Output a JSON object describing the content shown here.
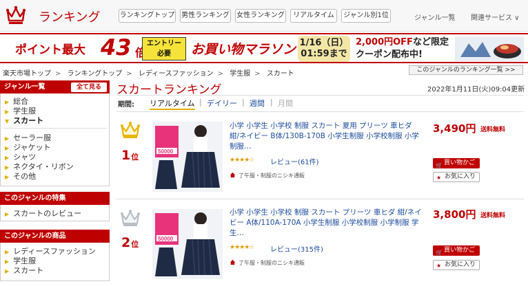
{
  "header": {
    "logo_text": "ランキング",
    "tabs": [
      {
        "label": "ランキングトップ"
      },
      {
        "label": "男性ランキング"
      },
      {
        "label": "女性ランキング"
      },
      {
        "label": "リアルタイム"
      },
      {
        "label": "ジャンル別1位"
      }
    ],
    "nav_genre_list": "ジャンル一覧",
    "nav_related": "関連サービス ∨"
  },
  "banner": {
    "point_text": "ポイント最大",
    "point_value": "43",
    "point_unit": "倍",
    "entry_line1": "エントリー",
    "entry_line2": "必要",
    "marathon": "お買い物マラソン",
    "date_line1": "1/16（日）",
    "date_line2": "01:59まで",
    "offer_line1_red": "2,000円OFF",
    "offer_line1_rest": "など限定",
    "offer_line2": "クーポン配布中!"
  },
  "breadcrumb": {
    "items": [
      "楽天市場トップ",
      "ランキングトップ",
      "レディースファッション",
      "学生服",
      "スカート"
    ],
    "separator": ">",
    "genre_ranking_link": "このジャンルのランキング一覧 >>"
  },
  "sidebar": {
    "genre_header": "ジャンル一覧",
    "see_all": "全て見る",
    "group1": [
      "総合",
      "学生服",
      "スカート"
    ],
    "group2": [
      "セーラー服",
      "ジャケット",
      "シャツ",
      "ネクタイ・リボン",
      "その他"
    ],
    "features_header": "このジャンルの特集",
    "features": [
      "スカートのレビュー"
    ],
    "products_header": "このジャンルの商品",
    "products": [
      "レディースファッション",
      "学生服",
      "スカート"
    ]
  },
  "main": {
    "title": "スカートランキング",
    "updated": "2022年1月11日(火)09:04更新",
    "period_label": "期間:",
    "period_tabs": [
      {
        "label": "リアルタイム"
      },
      {
        "label": "デイリー"
      },
      {
        "label": "週間"
      },
      {
        "label": "月間"
      }
    ],
    "period_sep": "|",
    "rank_suffix": "位",
    "items": [
      {
        "rank": "1",
        "name": "小学 小学生 小学校 制服 スカート 夏用 プリーツ 車ヒダ 紺/ネイビー B体/130B-170B 小学生制服 小学校制服 小学制服…",
        "stars": "★★★★☆",
        "review": "レビュー(61件)",
        "shop": "了午服・制服のニシキ通販",
        "price": "3,490円",
        "shipping": "送料無料",
        "cart": "買い物かご",
        "favorite": "お気に入り",
        "img_badge": "50000",
        "crown_color": "#e8b400"
      },
      {
        "rank": "2",
        "name": "小学 小学生 小学校 制服 スカート プリーツ 車ヒダ 紺/ネイビー A体/110A-170A 小学生制服 小学校制服 小学制服 学生…",
        "stars": "★★★★☆",
        "review": "レビュー(315件)",
        "shop": "了午服・制服のニシキ通販",
        "price": "3,800円",
        "shipping": "送料無料",
        "cart": "買い物かご",
        "favorite": "お気に入り",
        "img_badge": "50000",
        "crown_color": "#b8bec6"
      }
    ]
  },
  "colors": {
    "accent": "#bf0000",
    "link": "#1a4a9c",
    "gold": "#e8b400"
  }
}
